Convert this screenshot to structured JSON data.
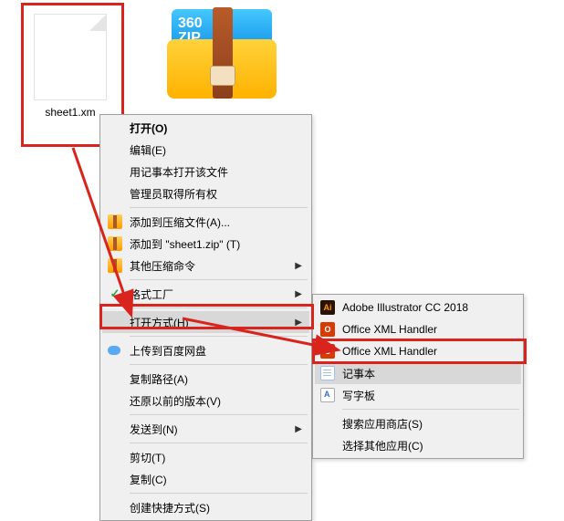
{
  "file": {
    "label": "sheet1.xm"
  },
  "zip_badge": {
    "line1": "360",
    "line2": "ZIP"
  },
  "menu1": {
    "open": "打开(O)",
    "edit": "编辑(E)",
    "open_with_notepad": "用记事本打开该文件",
    "admin_ownership": "管理员取得所有权",
    "add_to_archive": "添加到压缩文件(A)...",
    "add_to_sheet_zip": "添加到 \"sheet1.zip\" (T)",
    "other_compress": "其他压缩命令",
    "format_factory": "格式工厂",
    "open_with": "打开方式(H)",
    "upload_baidu": "上传到百度网盘",
    "copy_path": "复制路径(A)",
    "restore_versions": "还原以前的版本(V)",
    "send_to": "发送到(N)",
    "cut": "剪切(T)",
    "copy": "复制(C)",
    "create_shortcut": "创建快捷方式(S)"
  },
  "menu2": {
    "ai": "Adobe Illustrator CC 2018",
    "office_xml1": "Office XML Handler",
    "office_xml2": "Office XML Handler",
    "notepad": "记事本",
    "wordpad": "写字板",
    "search_store": "搜索应用商店(S)",
    "choose_other": "选择其他应用(C)"
  }
}
